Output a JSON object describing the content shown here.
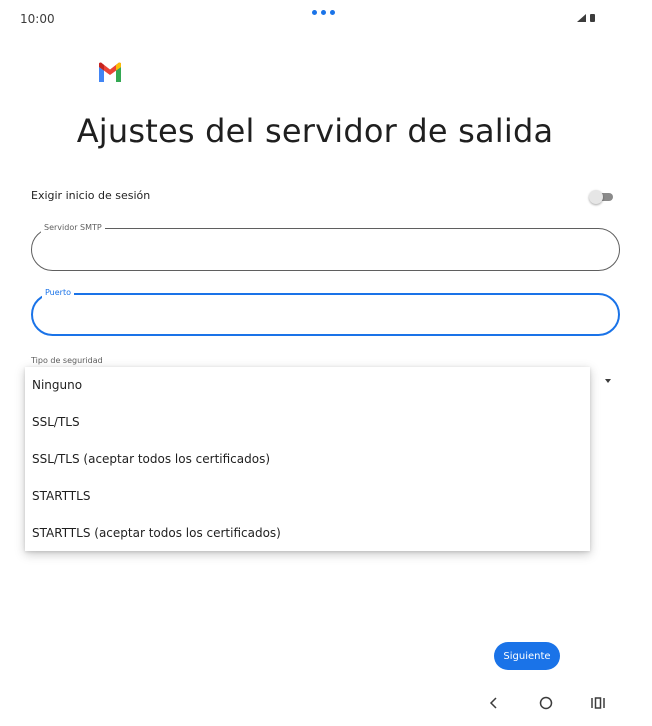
{
  "status_bar": {
    "time": "10:00"
  },
  "page": {
    "title": "Ajustes del servidor de salida"
  },
  "login": {
    "label": "Exigir inicio de sesión",
    "toggle_on": false
  },
  "smtp_field": {
    "label": "Servidor SMTP",
    "value": ""
  },
  "port_field": {
    "label": "Puerto",
    "value": ""
  },
  "security": {
    "label": "Tipo de seguridad",
    "options": [
      "Ninguno",
      "SSL/TLS",
      "SSL/TLS (aceptar todos los certificados)",
      "STARTTLS",
      "STARTTLS (aceptar todos los certificados)"
    ]
  },
  "actions": {
    "next_label": "Siguiente"
  },
  "colors": {
    "accent": "#1a73e8",
    "gmail_red": "#ea4335",
    "gmail_blue": "#4285f4",
    "gmail_green": "#34a853",
    "gmail_yellow": "#fbbc04"
  },
  "icons": {
    "logo": "gmail-logo",
    "nav": [
      "back-icon",
      "home-icon",
      "recents-icon"
    ]
  }
}
